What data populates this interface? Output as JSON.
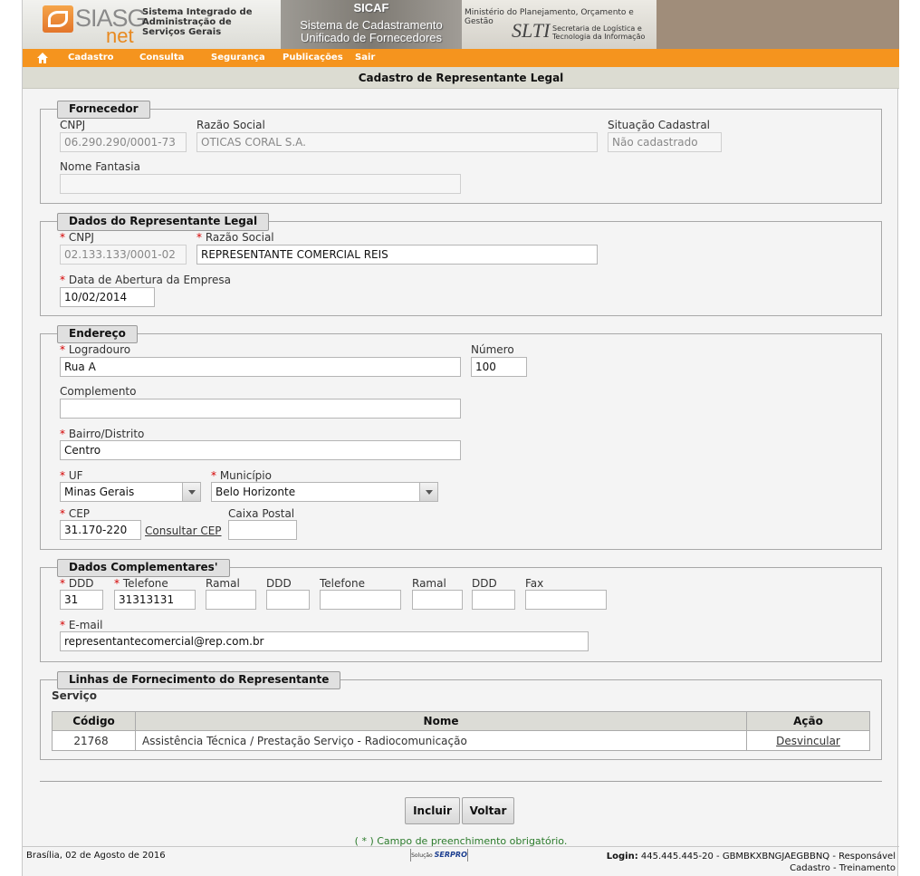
{
  "header": {
    "logo_siasg": "SIASG",
    "logo_net": "net",
    "siasg_line1": "Sistema Integrado de",
    "siasg_line2": "Administração de",
    "siasg_line3": "Serviços Gerais",
    "sicaf_title": "SICAF",
    "sicaf_line1": "Sistema de Cadastramento",
    "sicaf_line2": "Unificado de Fornecedores",
    "ministerio": "Ministério do Planejamento, Orçamento e Gestão",
    "slti": "SLTI",
    "slti_line1": "Secretaria de Logística e",
    "slti_line2": "Tecnologia da Informação"
  },
  "menu": {
    "items": [
      "Cadastro",
      "Consulta",
      "Segurança",
      "Publicações",
      "Sair"
    ]
  },
  "page_title": "Cadastro de Representante Legal",
  "fornecedor": {
    "legend": "Fornecedor",
    "cnpj_label": "CNPJ",
    "cnpj_value": "06.290.290/0001-73",
    "razao_label": "Razão Social",
    "razao_value": "OTICAS CORAL S.A.",
    "situacao_label": "Situação Cadastral",
    "situacao_value": "Não cadastrado",
    "fantasia_label": "Nome Fantasia",
    "fantasia_value": ""
  },
  "representante": {
    "legend": "Dados do Representante Legal",
    "cnpj_label": "CNPJ",
    "cnpj_value": "02.133.133/0001-02",
    "razao_label": "Razão Social",
    "razao_value": "REPRESENTANTE COMERCIAL REIS",
    "abertura_label": "Data de Abertura da Empresa",
    "abertura_value": "10/02/2014"
  },
  "endereco": {
    "legend": "Endereço",
    "logradouro_label": "Logradouro",
    "logradouro_value": "Rua A",
    "numero_label": "Número",
    "numero_value": "100",
    "complemento_label": "Complemento",
    "complemento_value": "",
    "bairro_label": "Bairro/Distrito",
    "bairro_value": "Centro",
    "uf_label": "UF",
    "uf_value": "Minas Gerais",
    "municipio_label": "Município",
    "municipio_value": "Belo Horizonte",
    "cep_label": "CEP",
    "cep_value": "31.170-220",
    "consultar_cep": "Consultar CEP",
    "caixa_label": "Caixa Postal",
    "caixa_value": ""
  },
  "complementares": {
    "legend": "Dados Complementares'",
    "ddd1_label": "DDD",
    "ddd1_value": "31",
    "tel1_label": "Telefone",
    "tel1_value": "31313131",
    "ramal1_label": "Ramal",
    "ramal1_value": "",
    "ddd2_label": "DDD",
    "ddd2_value": "",
    "tel2_label": "Telefone",
    "tel2_value": "",
    "ramal2_label": "Ramal",
    "ramal2_value": "",
    "ddd3_label": "DDD",
    "ddd3_value": "",
    "fax_label": "Fax",
    "fax_value": "",
    "email_label": "E-mail",
    "email_value": "representantecomercial@rep.com.br"
  },
  "linhas": {
    "legend": "Linhas de Fornecimento do Representante",
    "servico_label": "Serviço",
    "col_codigo": "Código",
    "col_nome": "Nome",
    "col_acao": "Ação",
    "rows": [
      {
        "codigo": "21768",
        "nome": "Assistência Técnica / Prestação Serviço - Radiocomunicação",
        "acao": "Desvincular"
      }
    ]
  },
  "buttons": {
    "incluir": "Incluir",
    "voltar": "Voltar"
  },
  "required_note": "( * ) Campo de preenchimento obrigatório.",
  "footer": {
    "date": "Brasília, 02 de Agosto de 2016",
    "solucao": "Solução",
    "serpro": "SERPRO",
    "login_label": "Login:",
    "login_value": "445.445.445-20 - GBMBKXBNGJAEGBBNQ - Responsável",
    "login_line2": "Cadastro - Treinamento"
  },
  "colors": {
    "menu_orange": "#f5941e",
    "required_red": "#d40000",
    "note_green": "#2a7a2a"
  }
}
